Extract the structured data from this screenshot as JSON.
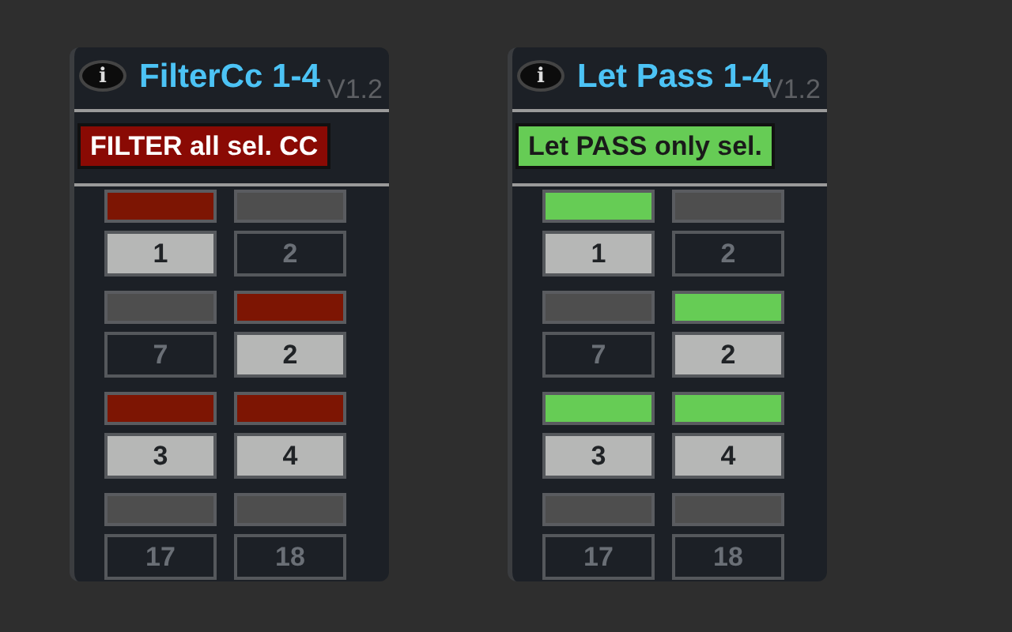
{
  "devices": [
    {
      "info_icon": "i",
      "title": "FilterCc 1-4",
      "version": "V1.2",
      "mode": {
        "label": "FILTER all sel. CC",
        "kind": "filter",
        "color": "#8a0a04"
      },
      "cells": [
        {
          "label": "1",
          "on": true
        },
        {
          "label": "2",
          "on": false
        },
        {
          "label": "7",
          "on": false
        },
        {
          "label": "2",
          "on": true
        },
        {
          "label": "3",
          "on": true
        },
        {
          "label": "4",
          "on": true
        },
        {
          "label": "17",
          "on": false
        },
        {
          "label": "18",
          "on": false
        }
      ]
    },
    {
      "info_icon": "i",
      "title": "Let Pass 1-4",
      "version": "V1.2",
      "mode": {
        "label": "Let PASS only sel.",
        "kind": "pass",
        "color": "#66cc55"
      },
      "cells": [
        {
          "label": "1",
          "on": true
        },
        {
          "label": "2",
          "on": false
        },
        {
          "label": "7",
          "on": false
        },
        {
          "label": "2",
          "on": true
        },
        {
          "label": "3",
          "on": true
        },
        {
          "label": "4",
          "on": true
        },
        {
          "label": "17",
          "on": false
        },
        {
          "label": "18",
          "on": false
        }
      ]
    }
  ]
}
